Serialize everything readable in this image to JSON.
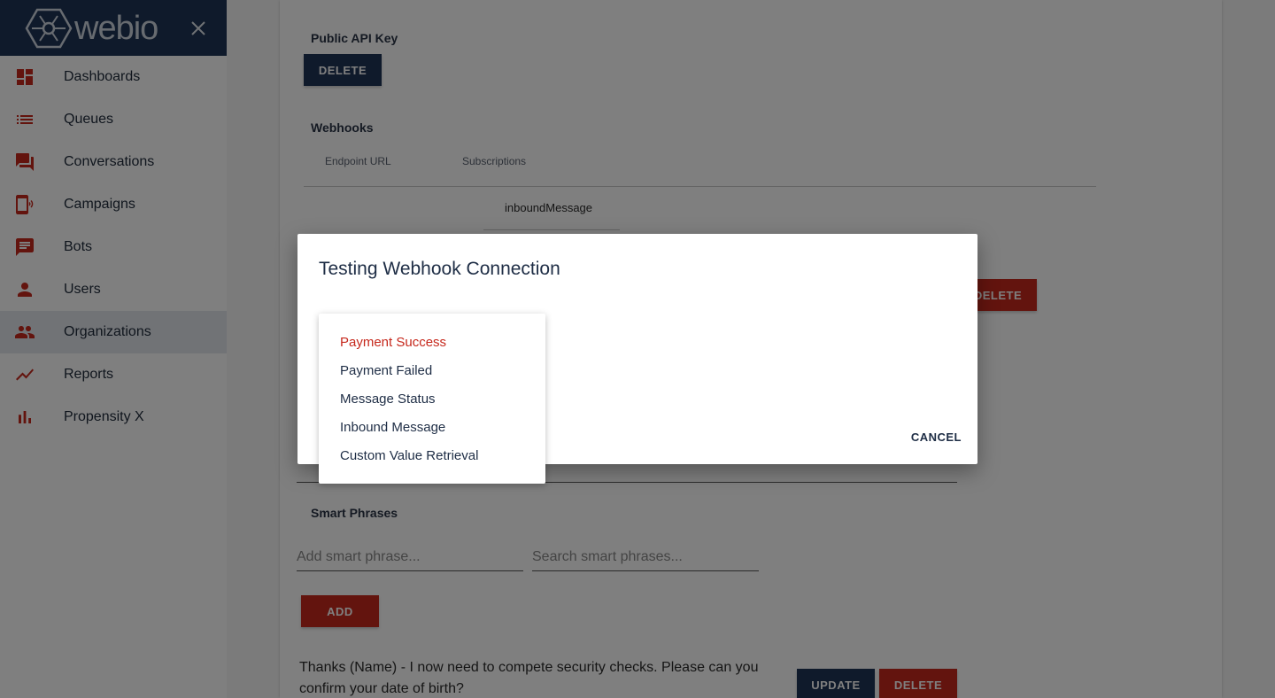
{
  "brand": {
    "name": "webio",
    "colors": {
      "navy": "#1e3456",
      "red": "#c6281c"
    }
  },
  "sidebar": {
    "close_icon": "close-icon",
    "items": [
      {
        "label": "Dashboards",
        "icon": "dashboard-icon",
        "active": false
      },
      {
        "label": "Queues",
        "icon": "list-icon",
        "active": false
      },
      {
        "label": "Conversations",
        "icon": "chat-bubbles-icon",
        "active": false
      },
      {
        "label": "Campaigns",
        "icon": "phone-broadcast-icon",
        "active": false
      },
      {
        "label": "Bots",
        "icon": "message-icon",
        "active": false
      },
      {
        "label": "Users",
        "icon": "person-icon",
        "active": false
      },
      {
        "label": "Organizations",
        "icon": "people-icon",
        "active": true
      },
      {
        "label": "Reports",
        "icon": "trending-up-icon",
        "active": false
      },
      {
        "label": "Propensity X",
        "icon": "bar-chart-icon",
        "active": false
      }
    ]
  },
  "public_api_key": {
    "title": "Public API Key",
    "delete_label": "DELETE"
  },
  "webhooks": {
    "title": "Webhooks",
    "columns": [
      "Endpoint URL",
      "Subscriptions"
    ],
    "rows": [
      {
        "endpoint": "",
        "subscription": "inboundMessage"
      }
    ],
    "delete_label": "DELETE"
  },
  "smart_phrases": {
    "title": "Smart Phrases",
    "add_placeholder": "Add smart phrase...",
    "search_placeholder": "Search smart phrases...",
    "add_label": "ADD",
    "phrases": [
      {
        "text": "Thanks (Name) - I now need to compete security checks.  Please can you confirm your date of birth?",
        "update_label": "UPDATE",
        "delete_label": "DELETE"
      }
    ]
  },
  "dialog": {
    "title": "Testing Webhook Connection",
    "cancel_label": "CANCEL",
    "menu": {
      "selected": "Payment Success",
      "options": [
        "Payment Success",
        "Payment Failed",
        "Message Status",
        "Inbound Message",
        "Custom Value Retrieval"
      ]
    }
  }
}
